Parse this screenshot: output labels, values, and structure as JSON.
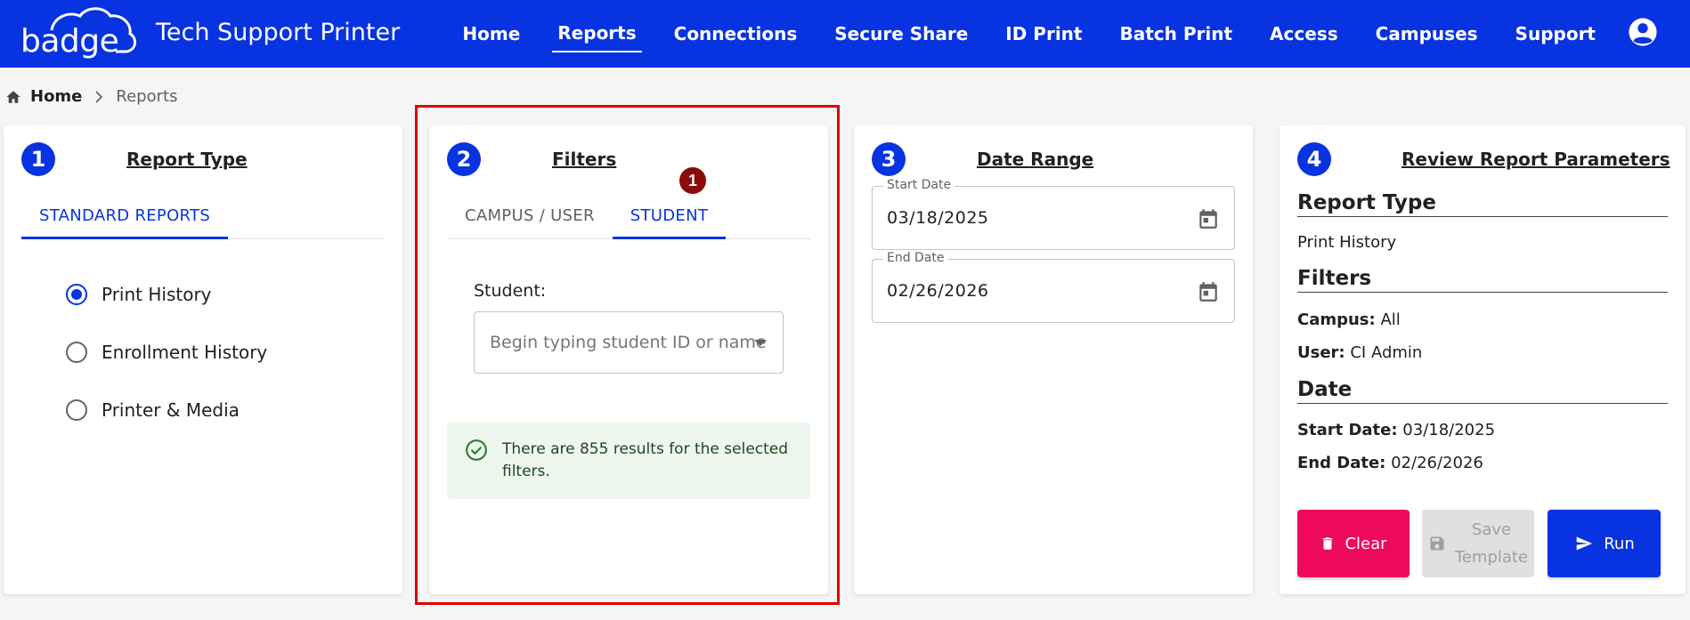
{
  "header": {
    "logo_text": "badge",
    "app_title": "Tech Support Printer",
    "nav": [
      {
        "label": "Home",
        "active": false
      },
      {
        "label": "Reports",
        "active": true
      },
      {
        "label": "Connections",
        "active": false
      },
      {
        "label": "Secure Share",
        "active": false
      },
      {
        "label": "ID Print",
        "active": false
      },
      {
        "label": "Batch Print",
        "active": false
      },
      {
        "label": "Access",
        "active": false
      },
      {
        "label": "Campuses",
        "active": false
      },
      {
        "label": "Support",
        "active": false
      }
    ],
    "account_icon": "account-circle-icon"
  },
  "breadcrumb": {
    "home": "Home",
    "current": "Reports"
  },
  "step1": {
    "number": "1",
    "title": "Report Type",
    "tab": "STANDARD REPORTS",
    "options": [
      {
        "label": "Print History",
        "checked": true
      },
      {
        "label": "Enrollment History",
        "checked": false
      },
      {
        "label": "Printer & Media",
        "checked": false
      }
    ]
  },
  "step2": {
    "number": "2",
    "title": "Filters",
    "tabs": [
      "CAMPUS / USER",
      "STUDENT"
    ],
    "active_tab": "STUDENT",
    "badge": "1",
    "student_label": "Student:",
    "student_placeholder": "Begin typing student ID or name",
    "alert": "There are 855 results for the selected filters."
  },
  "step3": {
    "number": "3",
    "title": "Date Range",
    "start_label": "Start Date",
    "start_value": "03/18/2025",
    "end_label": "End Date",
    "end_value": "02/26/2026"
  },
  "step4": {
    "number": "4",
    "title": "Review Report Parameters",
    "report_type_heading": "Report Type",
    "report_type_value": "Print History",
    "filters_heading": "Filters",
    "campus_key": "Campus:",
    "campus_value": "All",
    "user_key": "User:",
    "user_value": "CI Admin",
    "date_heading": "Date",
    "start_key": "Start Date:",
    "start_value": "03/18/2025",
    "end_key": "End Date:",
    "end_value": "02/26/2026",
    "buttons": {
      "clear": "Clear",
      "save_line1": "Save",
      "save_line2": "Template",
      "run": "Run"
    }
  },
  "colors": {
    "primary": "#0833e1",
    "clear": "#ee0a5a",
    "success_bg": "#edf7ed",
    "highlight": "#e00000",
    "badge": "#8b0a0a"
  }
}
